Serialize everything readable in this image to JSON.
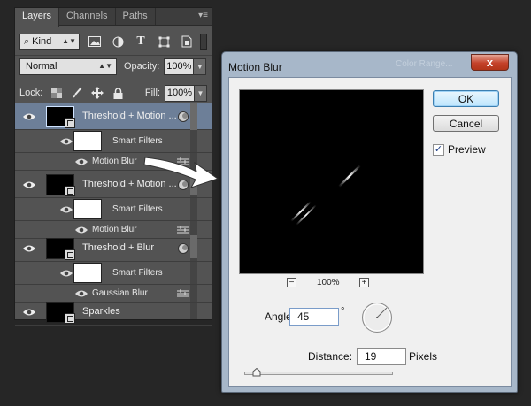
{
  "panel": {
    "tabs": [
      {
        "label": "Layers",
        "active": true
      },
      {
        "label": "Channels",
        "active": false
      },
      {
        "label": "Paths",
        "active": false
      }
    ],
    "filter_kind": "Kind",
    "blend_mode": "Normal",
    "opacity_label": "Opacity:",
    "opacity_value": "100%",
    "lock_label": "Lock:",
    "fill_label": "Fill:",
    "fill_value": "100%",
    "layers": [
      {
        "name": "Threshold + Motion ...",
        "selected": true,
        "smart_filters_label": "Smart Filters",
        "filter": "Motion Blur"
      },
      {
        "name": "Threshold + Motion ...",
        "selected": false,
        "smart_filters_label": "Smart Filters",
        "filter": "Motion Blur"
      },
      {
        "name": "Threshold + Blur",
        "selected": false,
        "smart_filters_label": "Smart Filters",
        "filter": "Gaussian Blur"
      },
      {
        "name": "Sparkles",
        "selected": false
      }
    ]
  },
  "dialog": {
    "title": "Motion Blur",
    "ghost_text": "Color Range...",
    "close_label": "x",
    "ok_label": "OK",
    "cancel_label": "Cancel",
    "preview_label": "Preview",
    "preview_checked": true,
    "zoom_minus": "−",
    "zoom_plus": "+",
    "zoom_level": "100%",
    "angle_label": "Angle:",
    "angle_value": "45",
    "degree_symbol": "°",
    "distance_label": "Distance:",
    "distance_value": "19",
    "distance_unit": "Pixels"
  },
  "colors": {
    "selected_layer": "#6d7f98",
    "dialog_frame": "#a7b7c9",
    "close_button": "#c4422a"
  }
}
